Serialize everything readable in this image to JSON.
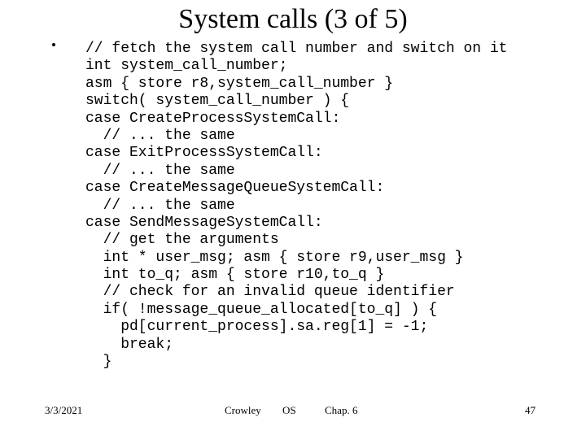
{
  "slide": {
    "title": "System calls (3 of 5)",
    "bullet_marker": "•",
    "code_lines": [
      "// fetch the system call number and switch on it",
      "int system_call_number;",
      "asm { store r8,system_call_number }",
      "switch( system_call_number ) {",
      "case CreateProcessSystemCall:",
      "  // ... the same",
      "case ExitProcessSystemCall:",
      "  // ... the same",
      "case CreateMessageQueueSystemCall:",
      "  // ... the same",
      "case SendMessageSystemCall:",
      "  // get the arguments",
      "  int * user_msg; asm { store r9,user_msg }",
      "  int to_q; asm { store r10,to_q }",
      "  // check for an invalid queue identifier",
      "  if( !message_queue_allocated[to_q] ) {",
      "    pd[current_process].sa.reg[1] = -1;",
      "    break;",
      "  }"
    ]
  },
  "footer": {
    "date": "3/3/2021",
    "author": "Crowley",
    "course": "OS",
    "chapter": "Chap. 6",
    "page_number": "47"
  },
  "colors": {
    "background": "#ffffff",
    "text": "#000000"
  }
}
